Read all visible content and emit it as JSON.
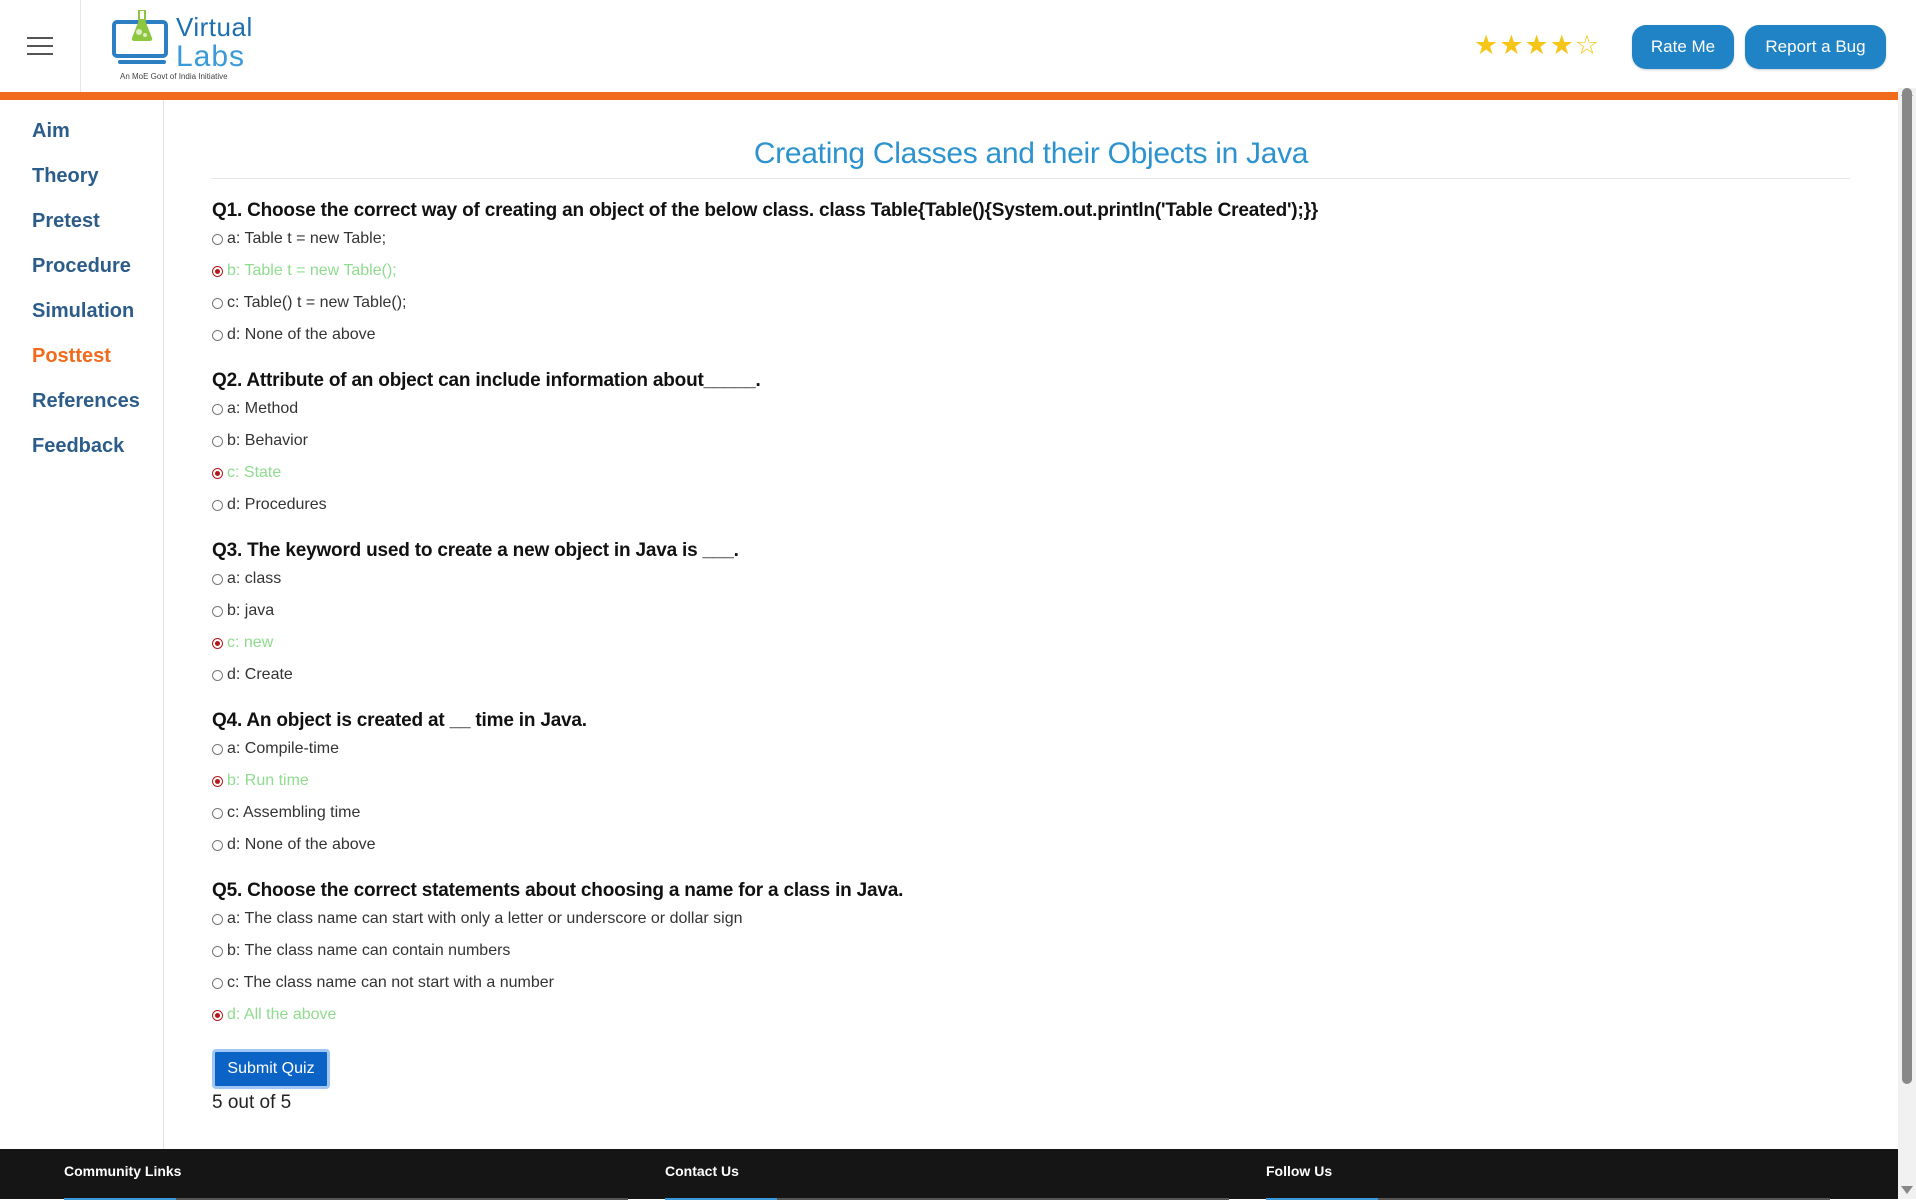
{
  "header": {
    "logo": {
      "line1": "Virtual",
      "line2": "Labs",
      "tagline": "An MoE Govt of India Initiative"
    },
    "rating": {
      "stars_filled": 4,
      "stars_total": 5,
      "icon_filled": "★",
      "icon_empty": "☆"
    },
    "rate_button": "Rate Me",
    "bug_button": "Report a Bug"
  },
  "sidebar": {
    "items": [
      {
        "label": "Aim",
        "active": false
      },
      {
        "label": "Theory",
        "active": false
      },
      {
        "label": "Pretest",
        "active": false
      },
      {
        "label": "Procedure",
        "active": false
      },
      {
        "label": "Simulation",
        "active": false
      },
      {
        "label": "Posttest",
        "active": true
      },
      {
        "label": "References",
        "active": false
      },
      {
        "label": "Feedback",
        "active": false
      }
    ]
  },
  "main": {
    "title": "Creating Classes and their Objects in Java",
    "questions": [
      {
        "text": "Q1. Choose the correct way of creating an object of the below class. class Table{Table(){System.out.println('Table Created');}}",
        "options": [
          "a: Table t = new Table;",
          "b: Table t = new Table();",
          "c: Table() t = new Table();",
          "d: None of the above"
        ],
        "selected": 1
      },
      {
        "text": "Q2. Attribute of an object can include information about_____.",
        "options": [
          "a: Method",
          "b: Behavior",
          "c: State",
          "d: Procedures"
        ],
        "selected": 2
      },
      {
        "text": "Q3. The keyword used to create a new object in Java is ___.",
        "options": [
          "a: class",
          "b: java",
          "c: new",
          "d: Create"
        ],
        "selected": 2
      },
      {
        "text": "Q4. An object is created at __ time in Java.",
        "options": [
          "a: Compile-time",
          "b: Run time",
          "c: Assembling time",
          "d: None of the above"
        ],
        "selected": 1
      },
      {
        "text": "Q5. Choose the correct statements about choosing a name for a class in Java.",
        "options": [
          "a: The class name can start with only a letter or underscore or dollar sign",
          "b: The class name can contain numbers",
          "c: The class name can not start with a number",
          "d: All the above"
        ],
        "selected": 3
      }
    ],
    "submit_label": "Submit Quiz",
    "score": "5 out of 5"
  },
  "footer": {
    "columns": [
      "Community Links",
      "Contact Us",
      "Follow Us"
    ]
  },
  "colors": {
    "accent_orange": "#f26a1b",
    "title_blue": "#2c93cf",
    "button_blue": "#1f83c6",
    "correct_green": "#8fdc8f"
  }
}
